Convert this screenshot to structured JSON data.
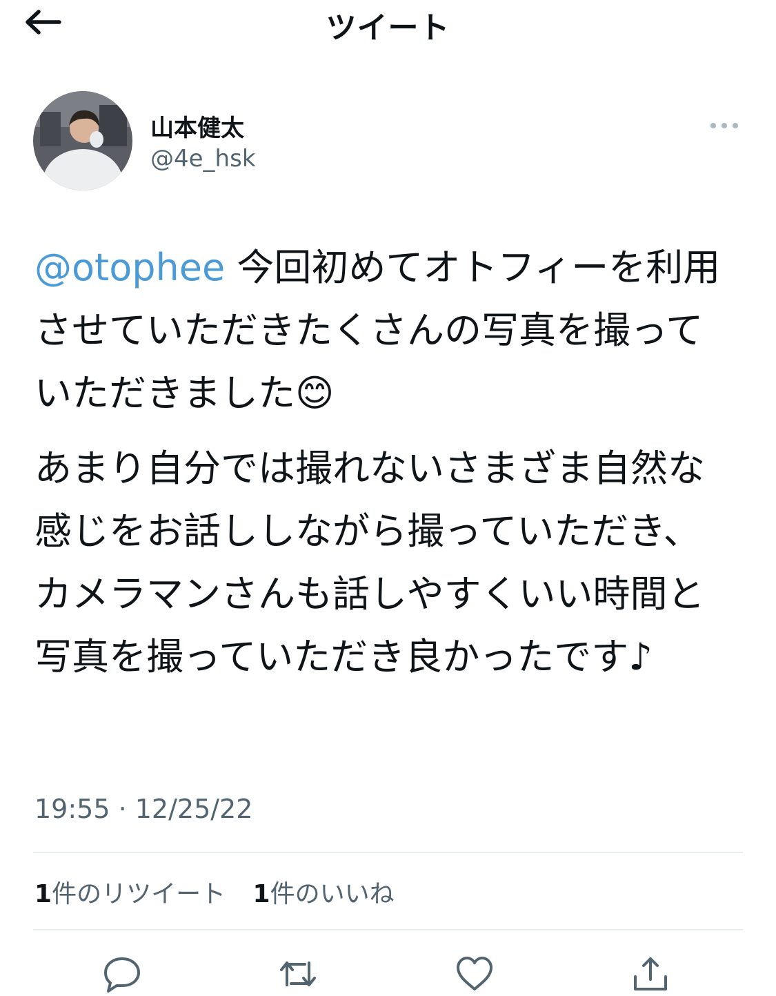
{
  "header": {
    "title": "ツイート",
    "back_icon": "arrow-left-icon"
  },
  "tweet": {
    "author": {
      "display_name": "山本健太",
      "handle": "@4e_hsk"
    },
    "mention": "@otophee",
    "paragraph1_text": " 今回初めてオトフィーを利用させていただきたくさんの写真を撮っていただきました",
    "emoji": "😊",
    "emoji_icon": "smiling-face-icon",
    "paragraph2_text": "あまり自分では撮れないさまざま自然な感じをお話ししながら撮っていただき、カメラマンさんも話しやすくいい時間と写真を撮っていただき良かったです",
    "paragraph2_music": "♪",
    "timestamp": "19:55 · 12/25/22",
    "retweets": {
      "count": "1",
      "label": "件のリツイート"
    },
    "likes": {
      "count": "1",
      "label": "件のいいね"
    }
  },
  "actions": [
    "reply-icon",
    "retweet-icon",
    "like-icon",
    "share-icon"
  ],
  "colors": {
    "link": "#4c9bd6",
    "secondary_text": "#536471",
    "divider": "#e6ecf0",
    "icon": "#536471"
  }
}
